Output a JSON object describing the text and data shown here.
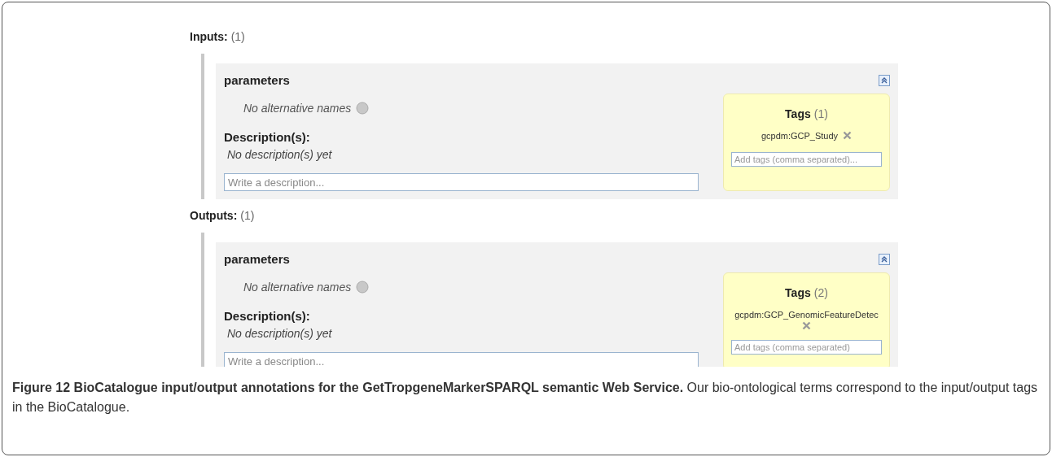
{
  "sections": [
    {
      "heading": "Inputs:",
      "count": "(1)",
      "panel": {
        "title": "parameters",
        "alt_names": "No alternative names",
        "desc_label": "Description(s):",
        "desc_text": "No description(s) yet",
        "desc_placeholder": "Write a description...",
        "tags_title": "Tags",
        "tags_count": "(1)",
        "tags": [
          "gcpdm:GCP_Study"
        ],
        "tag_placeholder": "Add tags (comma separated)..."
      }
    },
    {
      "heading": "Outputs:",
      "count": "(1)",
      "panel": {
        "title": "parameters",
        "alt_names": "No alternative names",
        "desc_label": "Description(s):",
        "desc_text": "No description(s) yet",
        "desc_placeholder": "Write a description...",
        "tags_title": "Tags",
        "tags_count": "(2)",
        "tags": [
          "gcpdm:GCP_GenomicFeatureDetec"
        ],
        "tag_placeholder": "Add tags (comma separated)"
      }
    }
  ],
  "caption": "**Figure 12 BioCatalogue input/output annotations for the GetTropgeneMarkerSPARQL semantic Web Service.** Our bio-ontological terms correspond to the input/output tags in the BioCatalogue."
}
